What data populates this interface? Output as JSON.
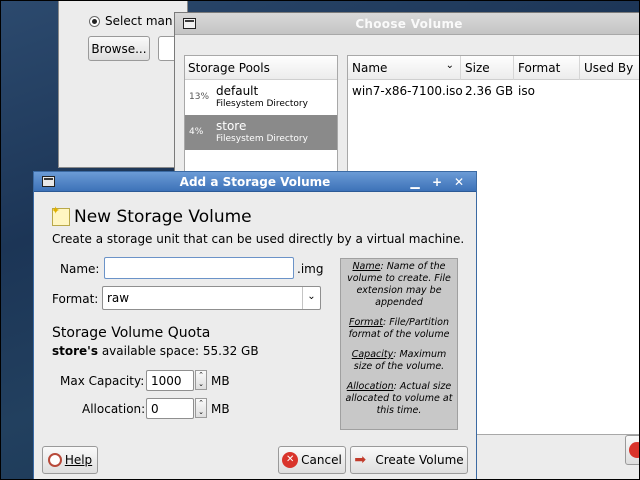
{
  "back_window": {
    "radio_label": "Select man",
    "browse_label": "Browse..."
  },
  "choose_volume": {
    "title": "Choose Volume",
    "pools_header": "Storage Pools",
    "pools": [
      {
        "percent": "13%",
        "name": "default",
        "type": "Filesystem Directory",
        "selected": false
      },
      {
        "percent": "4%",
        "name": "store",
        "type": "Filesystem Directory",
        "selected": true
      }
    ],
    "columns": [
      "Name",
      "Size",
      "Format",
      "Used By"
    ],
    "volumes": [
      {
        "name": "win7-x86-7100.iso",
        "size": "2.36 GB",
        "format": "iso",
        "used_by": ""
      }
    ]
  },
  "add_volume": {
    "title": "Add a Storage Volume",
    "heading": "New Storage Volume",
    "description": "Create a storage unit that can be used directly by a virtual machine.",
    "name_label": "Name:",
    "name_value": "",
    "name_suffix": ".img",
    "format_label": "Format:",
    "format_value": "raw",
    "quota_heading": "Storage Volume Quota",
    "pool_name_bold": "store's",
    "available_text": " available space: 55.32 GB",
    "max_capacity_label": "Max Capacity:",
    "max_capacity_value": "1000",
    "allocation_label": "Allocation:",
    "allocation_value": "0",
    "unit": "MB",
    "help": [
      {
        "term": "Name",
        "text": ": Name of the volume to create. File extension may be appended"
      },
      {
        "term": "Format",
        "text": ": File/Partition format of the volume"
      },
      {
        "term": "Capacity",
        "text": ": Maximum size of the volume."
      },
      {
        "term": "Allocation",
        "text": ": Actual size allocated to volume at this time."
      }
    ],
    "help_button": "Help",
    "cancel_button": "Cancel",
    "create_button": "Create Volume"
  },
  "colors": {
    "title_active": "#3d72b8",
    "title_inactive": "#c4c4c4",
    "selection": "#8a8a8a",
    "cancel_red": "#d9342b",
    "help_box": "#c8c8c8"
  }
}
